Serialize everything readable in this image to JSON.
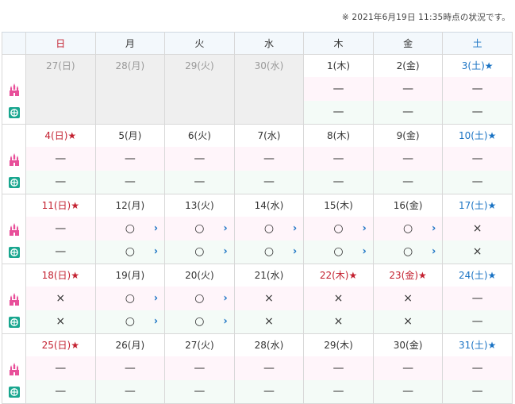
{
  "notice": "※ 2021年6月19日 11:35時点の状況です。",
  "weekdays": [
    "日",
    "月",
    "火",
    "水",
    "木",
    "金",
    "土"
  ],
  "colors": {
    "sunday": "#c3202f",
    "saturday": "#1a73c4",
    "arrow": "#1a73c4",
    "land_bg": "#fff5fa",
    "sea_bg": "#f4fbf7",
    "other_month_bg": "#efefef"
  },
  "icons": {
    "land": "castle-icon",
    "sea": "globe-icon",
    "more": "chevron-right-icon"
  },
  "weeks": [
    {
      "days": [
        {
          "label": "27(日)",
          "type": "other",
          "land": "",
          "sea": "",
          "land_link": false,
          "sea_link": false
        },
        {
          "label": "28(月)",
          "type": "other",
          "land": "",
          "sea": "",
          "land_link": false,
          "sea_link": false
        },
        {
          "label": "29(火)",
          "type": "other",
          "land": "",
          "sea": "",
          "land_link": false,
          "sea_link": false
        },
        {
          "label": "30(水)",
          "type": "other",
          "land": "",
          "sea": "",
          "land_link": false,
          "sea_link": false
        },
        {
          "label": "1(木)",
          "type": "normal",
          "land": "—",
          "sea": "—",
          "land_link": false,
          "sea_link": false
        },
        {
          "label": "2(金)",
          "type": "normal",
          "land": "—",
          "sea": "—",
          "land_link": false,
          "sea_link": false
        },
        {
          "label": "3(土)★",
          "type": "blue",
          "land": "—",
          "sea": "—",
          "land_link": false,
          "sea_link": false
        }
      ]
    },
    {
      "days": [
        {
          "label": "4(日)★",
          "type": "red",
          "land": "—",
          "sea": "—",
          "land_link": false,
          "sea_link": false
        },
        {
          "label": "5(月)",
          "type": "normal",
          "land": "—",
          "sea": "—",
          "land_link": false,
          "sea_link": false
        },
        {
          "label": "6(火)",
          "type": "normal",
          "land": "—",
          "sea": "—",
          "land_link": false,
          "sea_link": false
        },
        {
          "label": "7(水)",
          "type": "normal",
          "land": "—",
          "sea": "—",
          "land_link": false,
          "sea_link": false
        },
        {
          "label": "8(木)",
          "type": "normal",
          "land": "—",
          "sea": "—",
          "land_link": false,
          "sea_link": false
        },
        {
          "label": "9(金)",
          "type": "normal",
          "land": "—",
          "sea": "—",
          "land_link": false,
          "sea_link": false
        },
        {
          "label": "10(土)★",
          "type": "blue",
          "land": "—",
          "sea": "—",
          "land_link": false,
          "sea_link": false
        }
      ]
    },
    {
      "days": [
        {
          "label": "11(日)★",
          "type": "red",
          "land": "—",
          "sea": "—",
          "land_link": false,
          "sea_link": false
        },
        {
          "label": "12(月)",
          "type": "normal",
          "land": "○",
          "sea": "○",
          "land_link": true,
          "sea_link": true
        },
        {
          "label": "13(火)",
          "type": "normal",
          "land": "○",
          "sea": "○",
          "land_link": true,
          "sea_link": true
        },
        {
          "label": "14(水)",
          "type": "normal",
          "land": "○",
          "sea": "○",
          "land_link": true,
          "sea_link": true
        },
        {
          "label": "15(木)",
          "type": "normal",
          "land": "○",
          "sea": "○",
          "land_link": true,
          "sea_link": true
        },
        {
          "label": "16(金)",
          "type": "normal",
          "land": "○",
          "sea": "○",
          "land_link": true,
          "sea_link": true
        },
        {
          "label": "17(土)★",
          "type": "blue",
          "land": "×",
          "sea": "×",
          "land_link": false,
          "sea_link": false
        }
      ]
    },
    {
      "days": [
        {
          "label": "18(日)★",
          "type": "red",
          "land": "×",
          "sea": "×",
          "land_link": false,
          "sea_link": false
        },
        {
          "label": "19(月)",
          "type": "normal",
          "land": "○",
          "sea": "○",
          "land_link": true,
          "sea_link": true
        },
        {
          "label": "20(火)",
          "type": "normal",
          "land": "○",
          "sea": "○",
          "land_link": true,
          "sea_link": true
        },
        {
          "label": "21(水)",
          "type": "normal",
          "land": "×",
          "sea": "×",
          "land_link": false,
          "sea_link": false
        },
        {
          "label": "22(木)★",
          "type": "red",
          "land": "×",
          "sea": "×",
          "land_link": false,
          "sea_link": false
        },
        {
          "label": "23(金)★",
          "type": "red",
          "land": "×",
          "sea": "×",
          "land_link": false,
          "sea_link": false
        },
        {
          "label": "24(土)★",
          "type": "blue",
          "land": "—",
          "sea": "—",
          "land_link": false,
          "sea_link": false
        }
      ]
    },
    {
      "days": [
        {
          "label": "25(日)★",
          "type": "red",
          "land": "—",
          "sea": "—",
          "land_link": false,
          "sea_link": false
        },
        {
          "label": "26(月)",
          "type": "normal",
          "land": "—",
          "sea": "—",
          "land_link": false,
          "sea_link": false
        },
        {
          "label": "27(火)",
          "type": "normal",
          "land": "—",
          "sea": "—",
          "land_link": false,
          "sea_link": false
        },
        {
          "label": "28(水)",
          "type": "normal",
          "land": "—",
          "sea": "—",
          "land_link": false,
          "sea_link": false
        },
        {
          "label": "29(木)",
          "type": "normal",
          "land": "—",
          "sea": "—",
          "land_link": false,
          "sea_link": false
        },
        {
          "label": "30(金)",
          "type": "normal",
          "land": "—",
          "sea": "—",
          "land_link": false,
          "sea_link": false
        },
        {
          "label": "31(土)★",
          "type": "blue",
          "land": "—",
          "sea": "—",
          "land_link": false,
          "sea_link": false
        }
      ]
    }
  ]
}
